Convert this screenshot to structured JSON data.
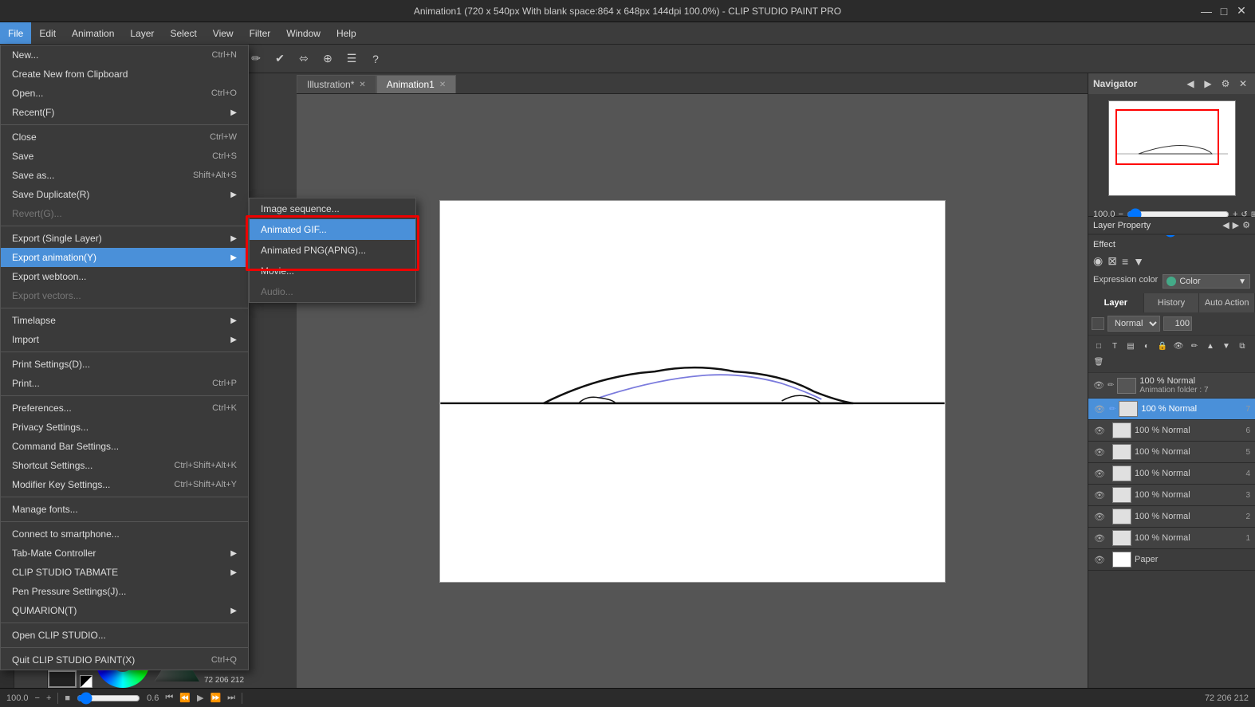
{
  "titlebar": {
    "title": "Animation1 (720 x 540px With blank space:864 x 648px 144dpi 100.0%) - CLIP STUDIO PAINT PRO",
    "controls": [
      "—",
      "□",
      "✕"
    ]
  },
  "menubar": {
    "items": [
      {
        "label": "File",
        "active": true
      },
      {
        "label": "Edit"
      },
      {
        "label": "Animation"
      },
      {
        "label": "Layer"
      },
      {
        "label": "Select"
      },
      {
        "label": "View"
      },
      {
        "label": "Filter"
      },
      {
        "label": "Window"
      },
      {
        "label": "Help"
      }
    ]
  },
  "file_menu": {
    "items": [
      {
        "label": "New...",
        "shortcut": "Ctrl+N",
        "type": "normal"
      },
      {
        "label": "Create New from Clipboard",
        "shortcut": "",
        "type": "normal"
      },
      {
        "label": "Open...",
        "shortcut": "Ctrl+O",
        "type": "normal"
      },
      {
        "label": "Recent(F)",
        "shortcut": "",
        "type": "submenu"
      },
      {
        "sep": true
      },
      {
        "label": "Close",
        "shortcut": "Ctrl+W",
        "type": "normal"
      },
      {
        "label": "Save",
        "shortcut": "Ctrl+S",
        "type": "normal"
      },
      {
        "label": "Save as...",
        "shortcut": "",
        "type": "normal"
      },
      {
        "label": "Save Duplicate(R)",
        "shortcut": "",
        "type": "submenu"
      },
      {
        "label": "Revert(G)...",
        "shortcut": "",
        "type": "disabled"
      },
      {
        "sep": true
      },
      {
        "label": "Export (Single Layer)",
        "shortcut": "",
        "type": "submenu"
      },
      {
        "label": "Export animation(Y)",
        "shortcut": "",
        "type": "highlighted submenu"
      },
      {
        "label": "Export webtoon...",
        "shortcut": "",
        "type": "normal"
      },
      {
        "label": "Export vectors...",
        "shortcut": "",
        "type": "disabled"
      },
      {
        "sep": true
      },
      {
        "label": "Timelapse",
        "shortcut": "",
        "type": "submenu"
      },
      {
        "label": "Import",
        "shortcut": "",
        "type": "submenu"
      },
      {
        "sep": true
      },
      {
        "label": "Print Settings(D)...",
        "shortcut": "",
        "type": "normal"
      },
      {
        "label": "Print...",
        "shortcut": "Ctrl+P",
        "type": "normal"
      },
      {
        "sep": true
      },
      {
        "label": "Preferences...",
        "shortcut": "Ctrl+K",
        "type": "normal"
      },
      {
        "label": "Privacy Settings...",
        "shortcut": "",
        "type": "normal"
      },
      {
        "label": "Command Bar Settings...",
        "shortcut": "",
        "type": "normal"
      },
      {
        "label": "Shortcut Settings...",
        "shortcut": "Ctrl+Shift+Alt+K",
        "type": "normal"
      },
      {
        "label": "Modifier Key Settings...",
        "shortcut": "Ctrl+Shift+Alt+Y",
        "type": "normal"
      },
      {
        "sep": true
      },
      {
        "label": "Manage fonts...",
        "shortcut": "",
        "type": "normal"
      },
      {
        "sep": true
      },
      {
        "label": "Connect to smartphone...",
        "shortcut": "",
        "type": "normal"
      },
      {
        "label": "Tab-Mate Controller",
        "shortcut": "",
        "type": "submenu"
      },
      {
        "label": "CLIP STUDIO TABMATE",
        "shortcut": "",
        "type": "submenu"
      },
      {
        "label": "Pen Pressure Settings(J)...",
        "shortcut": "",
        "type": "normal"
      },
      {
        "label": "QUMARION(T)",
        "shortcut": "",
        "type": "submenu"
      },
      {
        "sep": true
      },
      {
        "label": "Open CLIP STUDIO...",
        "shortcut": "",
        "type": "normal"
      },
      {
        "sep": true
      },
      {
        "label": "Quit CLIP STUDIO PAINT(X)",
        "shortcut": "Ctrl+Q",
        "type": "normal"
      }
    ]
  },
  "export_submenu": {
    "items": [
      {
        "label": "Image sequence...",
        "type": "normal"
      },
      {
        "label": "Animated GIF...",
        "type": "highlighted"
      },
      {
        "label": "Animated PNG(APNG)...",
        "type": "normal"
      },
      {
        "label": "Movie...",
        "type": "normal"
      },
      {
        "label": "Audio...",
        "type": "disabled"
      }
    ]
  },
  "tabs": [
    {
      "label": "Illustration*",
      "active": false
    },
    {
      "label": "Animation1",
      "active": true
    }
  ],
  "navigator": {
    "title": "Navigator",
    "zoom": "100.0",
    "rotation": "0.0"
  },
  "layers": {
    "tabs": [
      "Layer",
      "History",
      "Auto Action"
    ],
    "blend_mode": "Normal",
    "opacity": "100",
    "group_name": "100 % Normal",
    "group_sub": "Animation folder : 7",
    "items": [
      {
        "name": "100 % Normal",
        "number": "7",
        "selected": true
      },
      {
        "name": "100 % Normal",
        "number": "6"
      },
      {
        "name": "100 % Normal",
        "number": "5"
      },
      {
        "name": "100 % Normal",
        "number": "4"
      },
      {
        "name": "100 % Normal",
        "number": "3"
      },
      {
        "name": "100 % Normal",
        "number": "2"
      },
      {
        "name": "100 % Normal",
        "number": "1"
      },
      {
        "name": "Paper",
        "number": ""
      }
    ]
  },
  "effect": {
    "title": "Effect",
    "expression_color_label": "Expression color",
    "expression_color_value": "Color"
  },
  "statusbar": {
    "zoom": "100.0",
    "frame": "0.6",
    "rgb": "72 206 212"
  },
  "colorpicker": {
    "r": "72",
    "g": "206",
    "b": "212"
  }
}
